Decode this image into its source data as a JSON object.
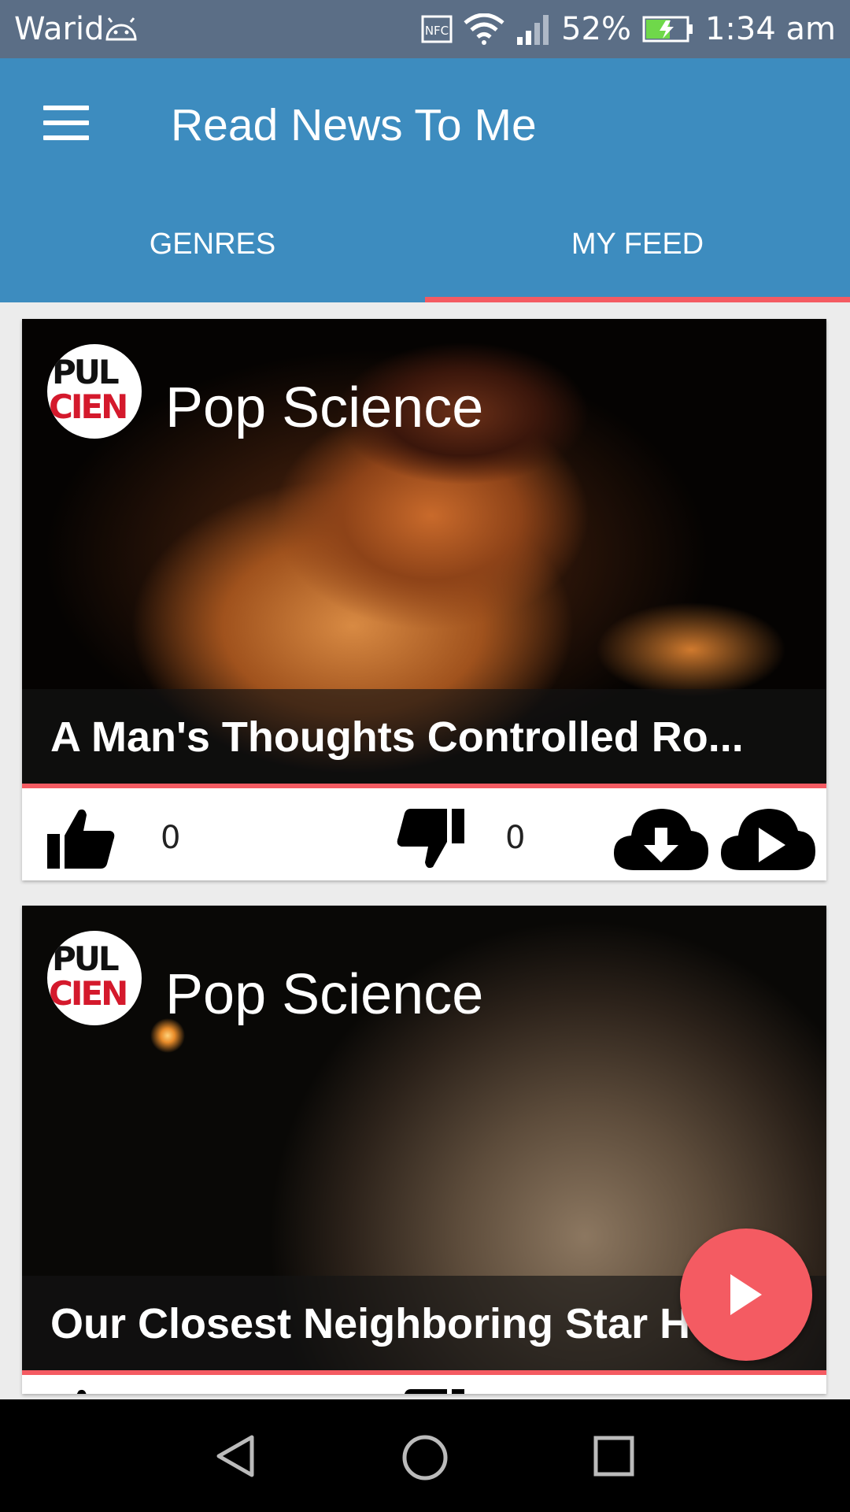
{
  "status_bar": {
    "carrier": "Warid",
    "nfc": "NFC",
    "battery": "52%",
    "time": "1:34 am",
    "icons": [
      "android-icon",
      "nfc-icon",
      "wifi-icon",
      "signal-icon",
      "battery-icon"
    ]
  },
  "app_bar": {
    "title": "Read News To Me",
    "menu_icon": "hamburger-menu-icon"
  },
  "tabs": [
    {
      "label": "GENRES",
      "selected": false
    },
    {
      "label": "MY FEED",
      "selected": true
    }
  ],
  "colors": {
    "app_bar": "#3d8cbf",
    "status_bar": "#5b6e86",
    "accent": "#f45b62",
    "background": "#ececec"
  },
  "feed": [
    {
      "source": "Pop Science",
      "logo_text": [
        "PUL",
        "CIEN"
      ],
      "headline": "A Man's Thoughts Controlled Ro...",
      "likes": "0",
      "dislikes": "0",
      "icons": [
        "thumbs-up-icon",
        "thumbs-down-icon",
        "cloud-download-icon",
        "cloud-play-icon"
      ]
    },
    {
      "source": "Pop Science",
      "logo_text": [
        "PUL",
        "CIEN"
      ],
      "headline": "Our Closest Neighboring Star H",
      "likes": "",
      "dislikes": ""
    }
  ],
  "fab": {
    "icon": "play-icon"
  },
  "nav_bar": {
    "icons": [
      "back-icon",
      "home-icon",
      "recents-icon"
    ]
  }
}
